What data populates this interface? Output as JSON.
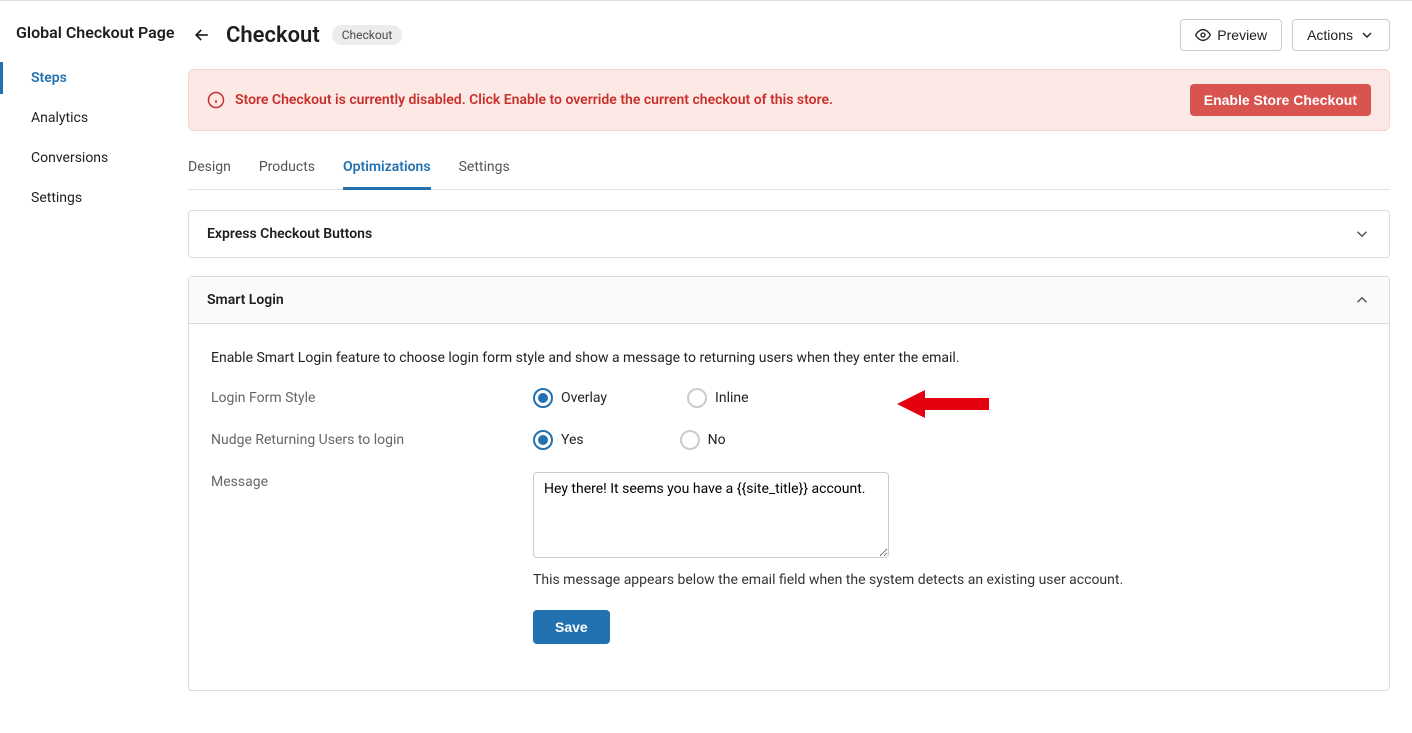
{
  "sidebar": {
    "title": "Global Checkout Page",
    "items": [
      {
        "label": "Steps",
        "active": true
      },
      {
        "label": "Analytics",
        "active": false
      },
      {
        "label": "Conversions",
        "active": false
      },
      {
        "label": "Settings",
        "active": false
      }
    ]
  },
  "header": {
    "title": "Checkout",
    "badge": "Checkout",
    "preview_label": "Preview",
    "actions_label": "Actions"
  },
  "alert": {
    "text": "Store Checkout is currently disabled. Click Enable to override the current checkout of this store.",
    "button": "Enable Store Checkout"
  },
  "tabs": [
    {
      "label": "Design",
      "active": false
    },
    {
      "label": "Products",
      "active": false
    },
    {
      "label": "Optimizations",
      "active": true
    },
    {
      "label": "Settings",
      "active": false
    }
  ],
  "panels": {
    "express": {
      "title": "Express Checkout Buttons"
    },
    "smart_login": {
      "title": "Smart Login",
      "description": "Enable Smart Login feature to choose login form style and show a message to returning users when they enter the email.",
      "login_form_style": {
        "label": "Login Form Style",
        "overlay": "Overlay",
        "inline": "Inline"
      },
      "nudge": {
        "label": "Nudge Returning Users to login",
        "yes": "Yes",
        "no": "No"
      },
      "message": {
        "label": "Message",
        "value": "Hey there! It seems you have a {{site_title}} account.",
        "help": "This message appears below the email field when the system detects an existing user account."
      },
      "save_label": "Save"
    }
  }
}
